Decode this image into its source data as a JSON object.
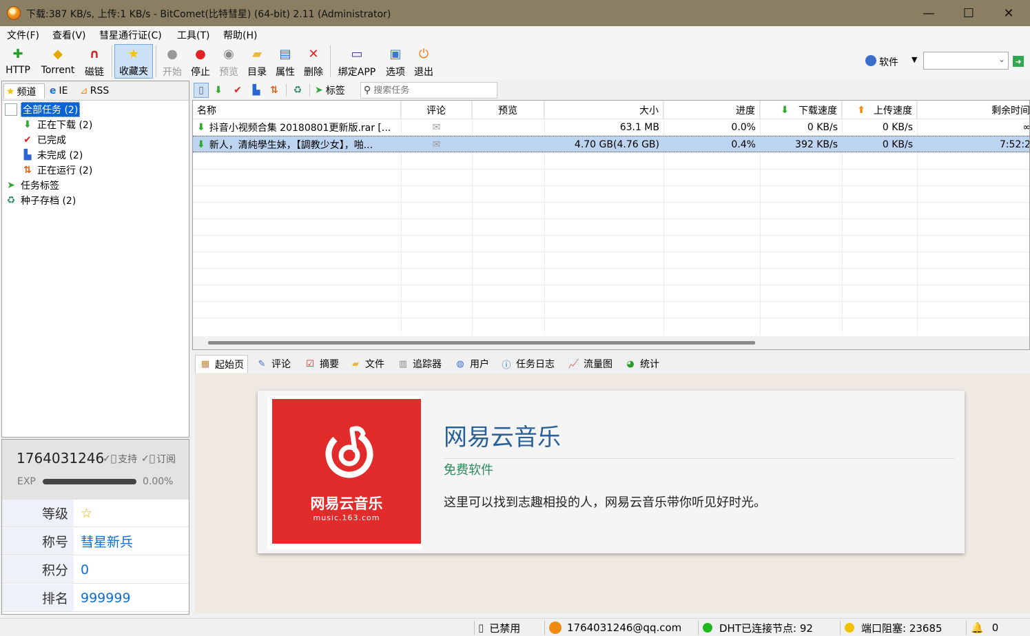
{
  "window": {
    "title": "下载:387 KB/s, 上传:1 KB/s - BitComet(比特彗星) (64-bit) 2.11 (Administrator)",
    "minimize": "—",
    "maximize": "☐",
    "close": "✕"
  },
  "menu": [
    "文件(F)",
    "查看(V)",
    "彗星通行证(C)",
    "工具(T)",
    "帮助(H)"
  ],
  "toolbar": {
    "buttons": [
      {
        "label": "HTTP",
        "icon": "add-http-icon"
      },
      {
        "label": "Torrent",
        "icon": "torrent-icon"
      },
      {
        "label": "磁链",
        "icon": "magnet-icon"
      },
      {
        "label": "收藏夹",
        "icon": "star-icon"
      },
      {
        "label": "开始",
        "icon": "play-icon"
      },
      {
        "label": "停止",
        "icon": "stop-icon"
      },
      {
        "label": "预览",
        "icon": "preview-icon"
      },
      {
        "label": "目录",
        "icon": "folder-icon"
      },
      {
        "label": "属性",
        "icon": "properties-icon"
      },
      {
        "label": "删除",
        "icon": "delete-icon"
      },
      {
        "label": "绑定APP",
        "icon": "bind-app-icon"
      },
      {
        "label": "选项",
        "icon": "options-icon"
      },
      {
        "label": "退出",
        "icon": "exit-icon"
      }
    ],
    "search_scope": "软件",
    "search_value": ""
  },
  "left_tabs": [
    "频道",
    "IE",
    "RSS"
  ],
  "tree": [
    {
      "label": "全部任务 (2)",
      "selected": true
    },
    {
      "label": "正在下载 (2)"
    },
    {
      "label": "已完成"
    },
    {
      "label": "未完成 (2)"
    },
    {
      "label": "正在运行 (2)"
    },
    {
      "label": "任务标签"
    },
    {
      "label": "种子存档 (2)"
    }
  ],
  "user": {
    "id": "1764031246",
    "support": "支持",
    "subscribe": "订阅",
    "exp_label": "EXP",
    "exp_value": "0.00%",
    "exp_progress": 0.0,
    "rows": [
      {
        "key": "等级",
        "value": "☆"
      },
      {
        "key": "称号",
        "value": "彗星新兵"
      },
      {
        "key": "积分",
        "value": "0"
      },
      {
        "key": "排名",
        "value": "999999"
      }
    ]
  },
  "task_toolbar": {
    "tag_label": "标签",
    "search_placeholder": "搜索任务"
  },
  "columns": [
    "名称",
    "评论",
    "预览",
    "大小",
    "进度",
    "下载速度",
    "上传速度",
    "剩余时间"
  ],
  "tasks": [
    {
      "name": "抖音小视频合集 20180801更新版.rar [...",
      "size": "63.1 MB",
      "progress": "0.0%",
      "down": "0 KB/s",
      "up": "0 KB/s",
      "remaining": "∞"
    },
    {
      "name": "新人，清純學生妹，【調教少女】，啪...",
      "size": "4.70 GB(4.76 GB)",
      "progress": "0.4%",
      "down": "392 KB/s",
      "up": "0 KB/s",
      "remaining": "7:52:2"
    }
  ],
  "bottom_tabs": [
    "起始页",
    "评论",
    "摘要",
    "文件",
    "追踪器",
    "用户",
    "任务日志",
    "流量图",
    "统计"
  ],
  "card": {
    "logo_text": "网易云音乐",
    "logo_url": "music.163.com",
    "title": "网易云音乐",
    "subtitle": "免费软件",
    "desc": "这里可以找到志趣相投的人，网易云音乐带你听见好时光。",
    "logo_color": "#e22b2b",
    "title_color": "#2a6198",
    "subtitle_color": "#2b8a5a"
  },
  "status": {
    "disabled": "已禁用",
    "account": "1764031246@qq.com",
    "dht": "DHT已连接节点:  92",
    "port": "端口阻塞:  23685",
    "alerts": "0"
  }
}
